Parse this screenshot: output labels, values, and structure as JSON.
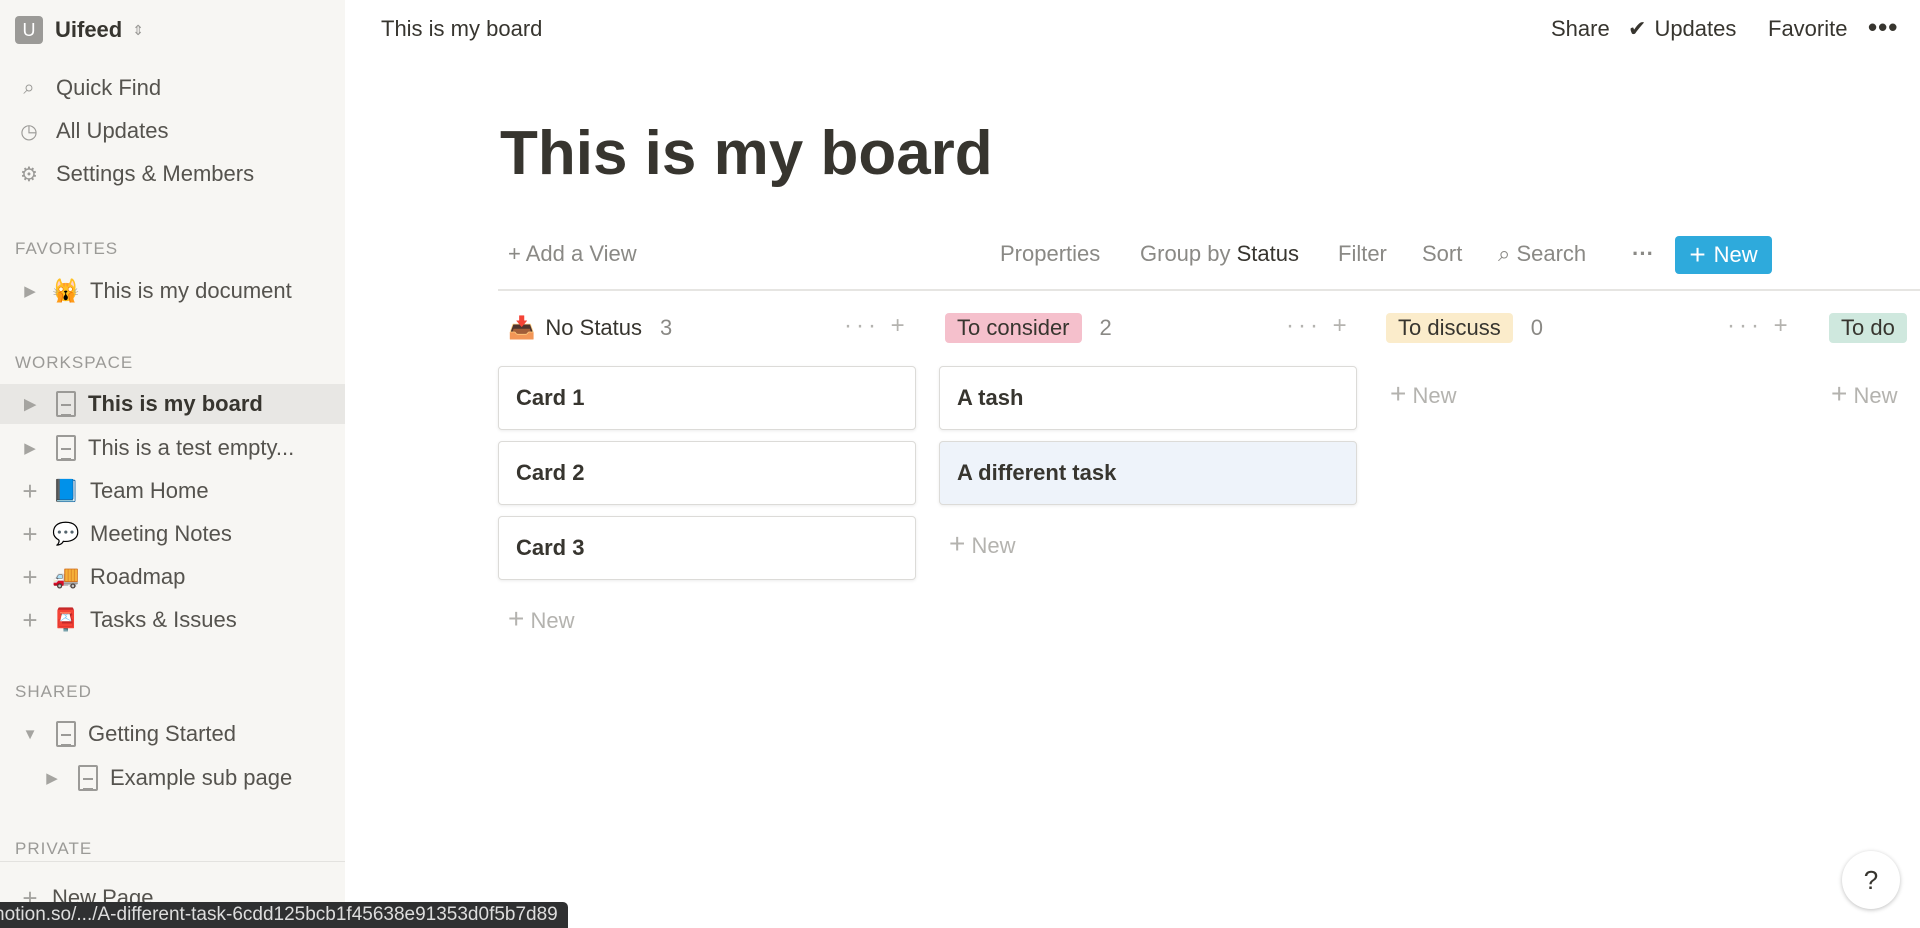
{
  "workspace": {
    "initial": "U",
    "name": "Uifeed"
  },
  "nav": [
    {
      "label": "Quick Find",
      "icon": "search-icon"
    },
    {
      "label": "All Updates",
      "icon": "clock-icon"
    },
    {
      "label": "Settings & Members",
      "icon": "gear-icon"
    }
  ],
  "favorites": {
    "heading": "FAVORITES",
    "items": [
      {
        "label": "This is my document",
        "emoji": "🙀"
      }
    ]
  },
  "workspace_section": {
    "heading": "WORKSPACE",
    "items": [
      {
        "label": "This is my board",
        "selected": true
      },
      {
        "label": "This is a test empty..."
      },
      {
        "label": "Team Home",
        "emoji": "📘"
      },
      {
        "label": "Meeting Notes",
        "emoji": "💬"
      },
      {
        "label": "Roadmap",
        "emoji": "🚚"
      },
      {
        "label": "Tasks & Issues",
        "emoji": "📮"
      }
    ]
  },
  "shared": {
    "heading": "SHARED",
    "items": [
      {
        "label": "Getting Started"
      },
      {
        "label": "Example sub page"
      }
    ]
  },
  "private": {
    "heading": "PRIVATE",
    "new_page": "New Page"
  },
  "status_url": "notion.so/.../A-different-task-6cdd125bcb1f45638e91353d0f5b7d89",
  "topbar": {
    "title": "This is my board",
    "share": "Share",
    "updates": "Updates",
    "favorite": "Favorite"
  },
  "page": {
    "title": "This is my board"
  },
  "toolbar": {
    "add_view": "+ Add a View",
    "properties": "Properties",
    "group_by": "Group by",
    "group_value": "Status",
    "filter": "Filter",
    "sort": "Sort",
    "search": "Search",
    "new": "New",
    "accent": "#2eaadc"
  },
  "columns": [
    {
      "label": "No Status",
      "count": "3",
      "color": "",
      "cards": [
        "Card 1",
        "Card 2",
        "Card 3"
      ]
    },
    {
      "label": "To consider",
      "count": "2",
      "color": "#f5c0cc",
      "cards": [
        "A tash",
        "A different task"
      ]
    },
    {
      "label": "To discuss",
      "count": "0",
      "color": "#fbeccb",
      "cards": []
    },
    {
      "label": "To do",
      "count": "",
      "color": "#cfe8de",
      "cards": []
    }
  ],
  "new_label": "New",
  "help": "?"
}
